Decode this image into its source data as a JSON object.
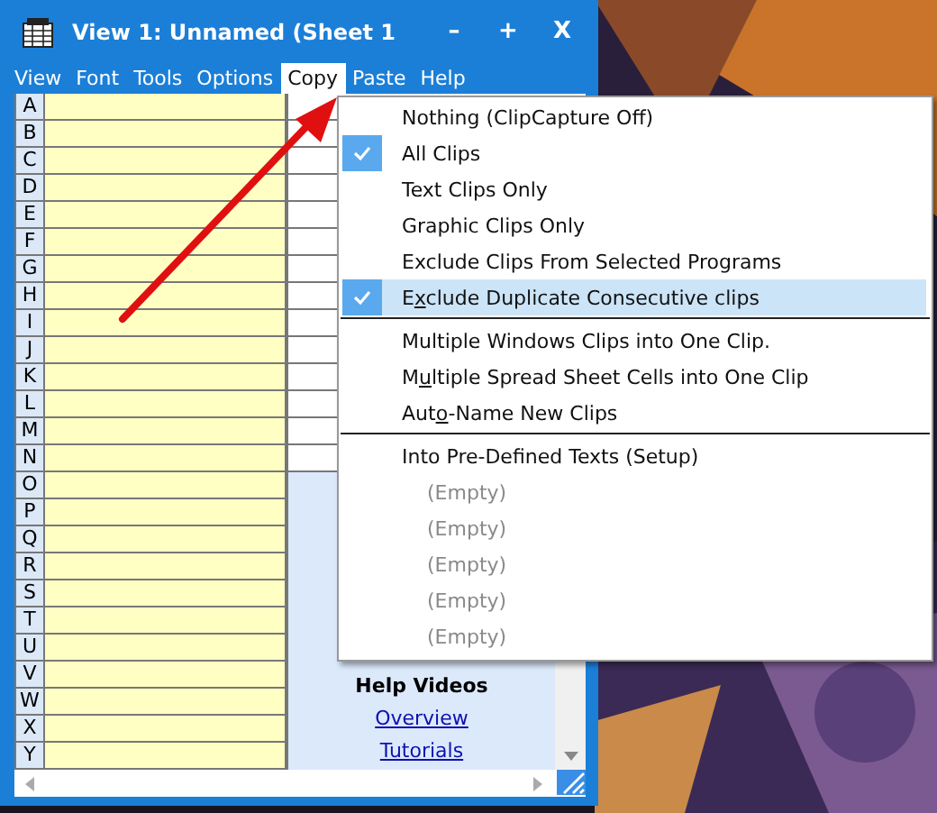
{
  "window": {
    "title": "View 1: Unnamed (Sheet 1",
    "controls": [
      "–",
      "+",
      "X"
    ]
  },
  "menu_bar": [
    {
      "label": "View",
      "selected": false
    },
    {
      "label": "Font",
      "selected": false
    },
    {
      "label": "Tools",
      "selected": false
    },
    {
      "label": "Options",
      "selected": false
    },
    {
      "label": "Copy",
      "selected": true
    },
    {
      "label": "Paste",
      "selected": false
    },
    {
      "label": "Help",
      "selected": false
    }
  ],
  "row_labels": [
    "A",
    "B",
    "C",
    "D",
    "E",
    "F",
    "G",
    "H",
    "I",
    "J",
    "K",
    "L",
    "M",
    "N",
    "O",
    "P",
    "Q",
    "R",
    "S",
    "T",
    "U",
    "V",
    "W",
    "X",
    "Y"
  ],
  "help_panel": {
    "heading": "Help Videos",
    "links": [
      "Overview",
      "Tutorials"
    ]
  },
  "copy_menu": [
    {
      "kind": "option",
      "label": "Nothing (ClipCapture Off)",
      "checked": false,
      "selected": false,
      "disabled": false
    },
    {
      "kind": "option",
      "label": "All Clips",
      "checked": true,
      "selected": false,
      "disabled": false
    },
    {
      "kind": "option",
      "label": "Text Clips Only",
      "checked": false,
      "selected": false,
      "disabled": false
    },
    {
      "kind": "option",
      "label": "Graphic Clips Only",
      "checked": false,
      "selected": false,
      "disabled": false
    },
    {
      "kind": "option",
      "label": "Exclude Clips From Selected Programs",
      "checked": false,
      "selected": false,
      "disabled": false
    },
    {
      "kind": "option",
      "label_parts": [
        "E",
        "x",
        "clude Duplicate Consecutive clips"
      ],
      "checked": true,
      "selected": true,
      "disabled": false
    },
    {
      "kind": "separator"
    },
    {
      "kind": "option",
      "label": "Multiple Windows Clips into One Clip.",
      "checked": false,
      "selected": false,
      "disabled": false
    },
    {
      "kind": "option",
      "label_parts": [
        "M",
        "u",
        "ltiple Spread Sheet Cells into One Clip"
      ],
      "checked": false,
      "selected": false,
      "disabled": false
    },
    {
      "kind": "option",
      "label_parts": [
        "Aut",
        "o",
        "-Name New Clips"
      ],
      "checked": false,
      "selected": false,
      "disabled": false
    },
    {
      "kind": "separator"
    },
    {
      "kind": "option",
      "label": "Into Pre-Defined Texts (Setup)",
      "checked": false,
      "selected": false,
      "disabled": false
    },
    {
      "kind": "slot",
      "label": "(Empty)",
      "checked": false,
      "selected": false,
      "disabled": true
    },
    {
      "kind": "slot",
      "label": "(Empty)",
      "checked": false,
      "selected": false,
      "disabled": true
    },
    {
      "kind": "slot",
      "label": "(Empty)",
      "checked": false,
      "selected": false,
      "disabled": true
    },
    {
      "kind": "slot",
      "label": "(Empty)",
      "checked": false,
      "selected": false,
      "disabled": true
    },
    {
      "kind": "slot",
      "label": "(Empty)",
      "checked": false,
      "selected": false,
      "disabled": true
    }
  ]
}
